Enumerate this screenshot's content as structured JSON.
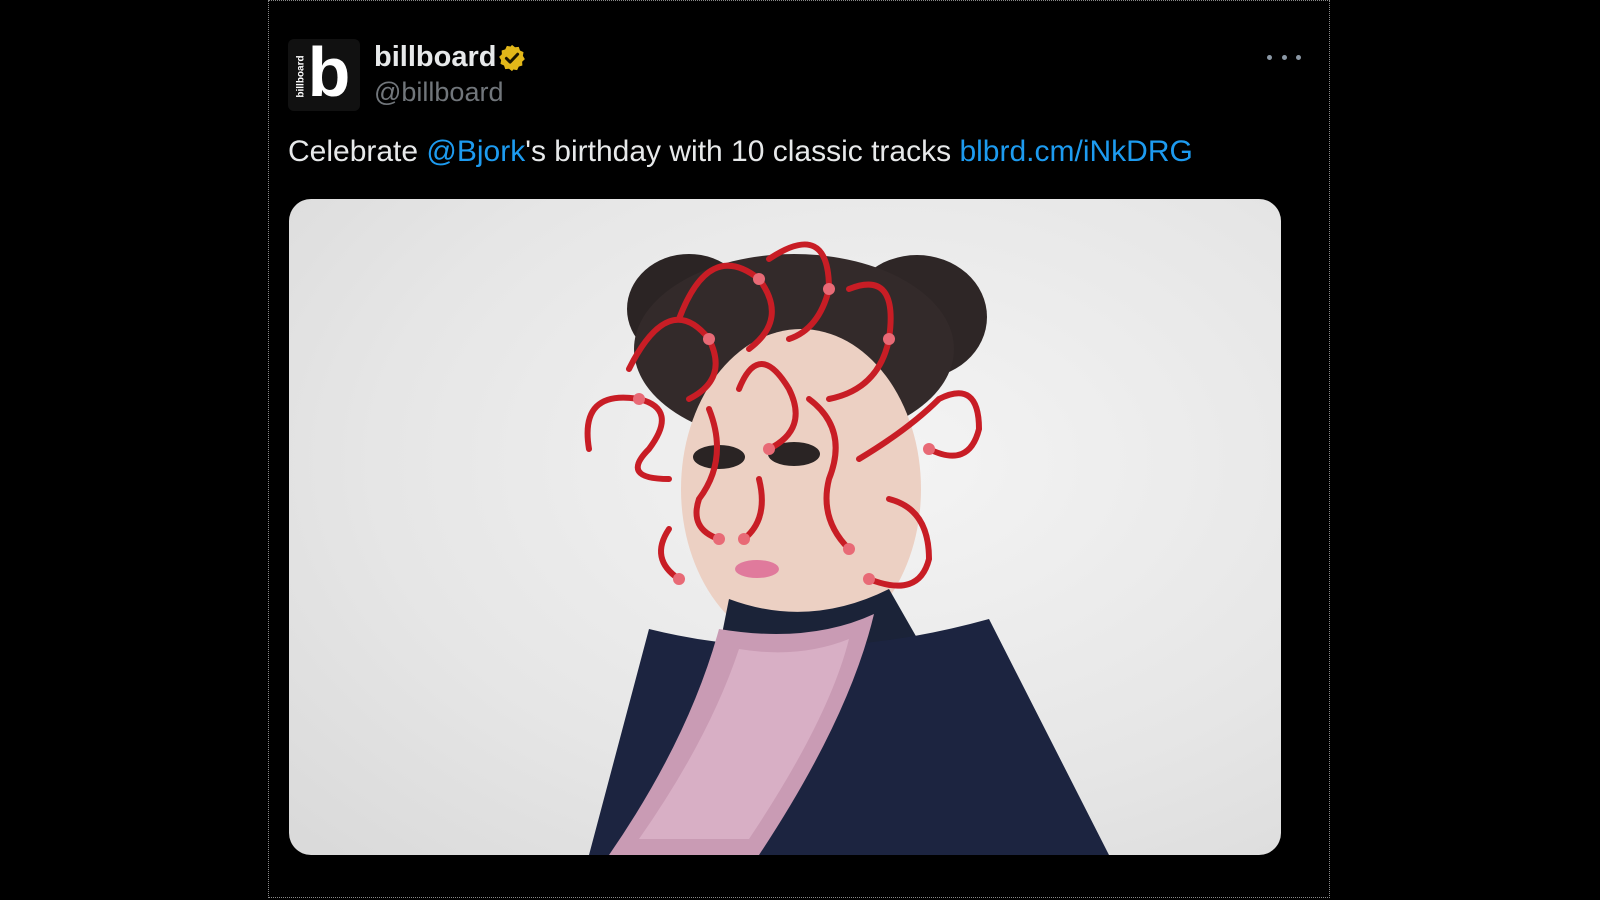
{
  "tweet": {
    "display_name": "billboard",
    "handle": "@billboard",
    "avatar": {
      "letter": "b",
      "wordmark": "billboard"
    },
    "verified_badge_color": "#e2b719",
    "text_before": "Celebrate ",
    "mention": "@Bjork",
    "text_middle": "'s birthday with 10 classic tracks ",
    "link": "blbrd.cm/iNkDRG",
    "link_color": "#1d9bf0",
    "media_icon": "photo-of-woman-with-red-wire-face-sculpture"
  },
  "icons": {
    "more": "more-horizontal-icon",
    "verified": "verified-badge-icon"
  }
}
